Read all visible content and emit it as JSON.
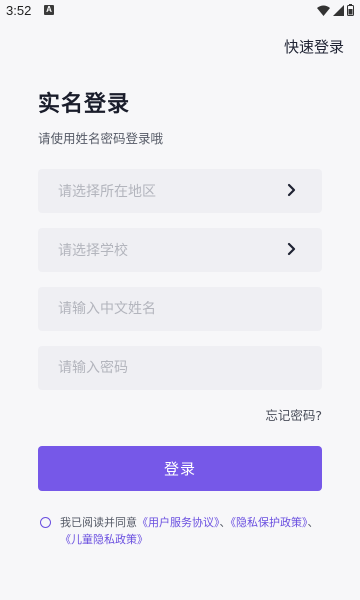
{
  "status_bar": {
    "time": "3:52",
    "notification_icon": "a-notification-icon",
    "wifi_icon": "wifi-icon",
    "signal_icon": "signal-icon",
    "battery_icon": "battery-icon"
  },
  "header": {
    "quick_login": "快速登录"
  },
  "main": {
    "title": "实名登录",
    "subtitle": "请使用姓名密码登录哦",
    "region_placeholder": "请选择所在地区",
    "school_placeholder": "请选择学校",
    "name_placeholder": "请输入中文姓名",
    "password_placeholder": "请输入密码",
    "forgot_password": "忘记密码?",
    "login_button": "登录"
  },
  "agreement": {
    "prefix": "我已阅读并同意",
    "user_agreement": "《用户服务协议》",
    "sep1": "、",
    "privacy_policy": "《隐私保护政策》",
    "sep2": "、",
    "children_policy": "《儿童隐私政策》"
  },
  "colors": {
    "accent": "#7658e8",
    "background": "#f7f7f9",
    "field_bg": "#efeff3"
  }
}
